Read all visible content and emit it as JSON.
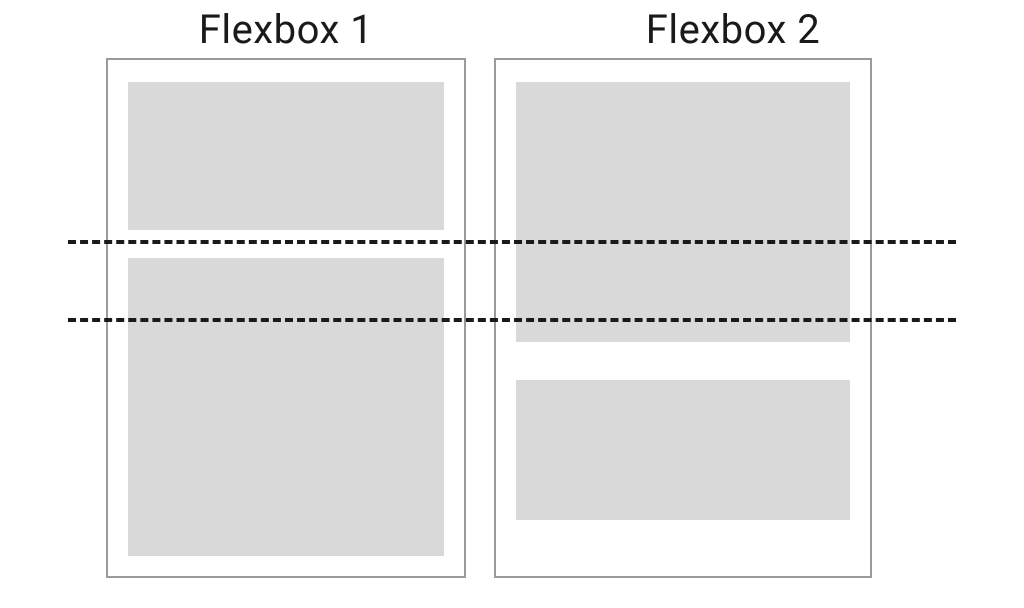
{
  "diagram": {
    "titles": {
      "left": "Flexbox 1",
      "right": "Flexbox 2"
    },
    "containers": {
      "left": {
        "items": [
          "top-item",
          "bottom-item"
        ]
      },
      "right": {
        "items": [
          "top-item",
          "bottom-item"
        ]
      }
    },
    "guides": [
      "upper-alignment-guide",
      "lower-alignment-guide"
    ],
    "colors": {
      "container_border": "#9a9a9a",
      "item_fill": "#d9d9d9",
      "guide": "#1a1a1a",
      "text": "#1a1a1a"
    }
  }
}
